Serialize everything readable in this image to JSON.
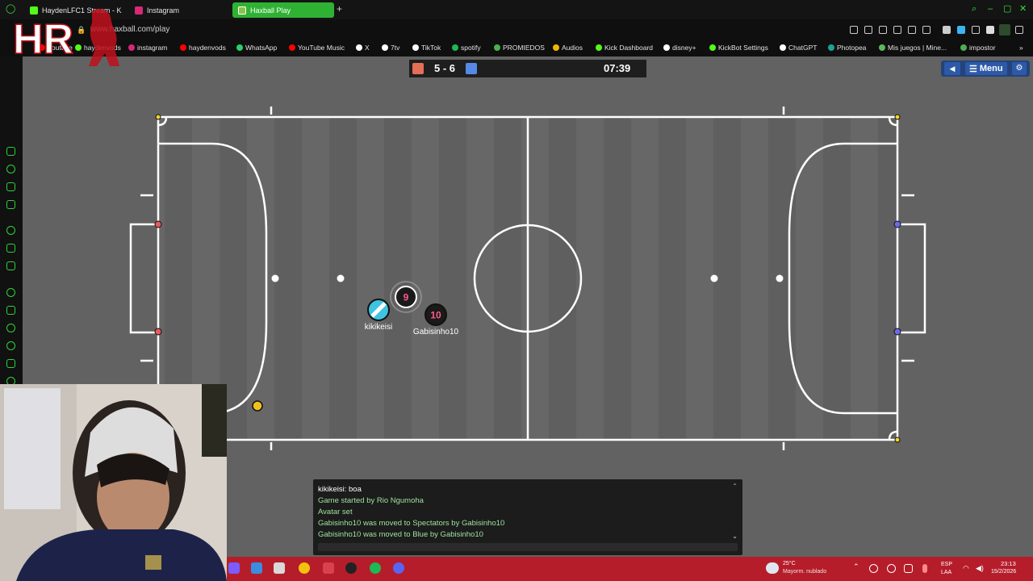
{
  "browser": {
    "tabs": [
      {
        "label": "HaydenLFC1 Stream - K",
        "color": "#53fc18",
        "active": false
      },
      {
        "label": "Instagram",
        "color": "#d62976",
        "active": false
      },
      {
        "label": "Haxball Play",
        "color": "#8bc34a",
        "active": true
      }
    ],
    "new_tab_label": "+",
    "url": "www.haxball.com/play",
    "bookmarks": [
      {
        "label": "Youtube",
        "color": "#ff0000"
      },
      {
        "label": "haydenvods",
        "color": "#53fc18"
      },
      {
        "label": "instagram",
        "color": "#d62976"
      },
      {
        "label": "haydenvods",
        "color": "#ff0000"
      },
      {
        "label": "WhatsApp",
        "color": "#25d366"
      },
      {
        "label": "YouTube Music",
        "color": "#ff0000"
      },
      {
        "label": "X",
        "color": "#ffffff"
      },
      {
        "label": "7tv",
        "color": "#ffffff"
      },
      {
        "label": "TikTok",
        "color": "#ffffff"
      },
      {
        "label": "spotify",
        "color": "#1db954"
      },
      {
        "label": "PROMIEDOS",
        "color": "#4caf50"
      },
      {
        "label": "Audios",
        "color": "#f2b705"
      },
      {
        "label": "Kick Dashboard",
        "color": "#53fc18"
      },
      {
        "label": "disney+",
        "color": "#ffffff"
      },
      {
        "label": "KickBot Settings",
        "color": "#53fc18"
      },
      {
        "label": "ChatGPT",
        "color": "#ffffff"
      },
      {
        "label": "Photopea",
        "color": "#18a497"
      },
      {
        "label": "Mis juegos | Mine...",
        "color": "#5cb85c"
      },
      {
        "label": "impostor",
        "color": "#4caf50"
      }
    ],
    "bookmarks_more": "»"
  },
  "overlay": {
    "logo_text": "HR"
  },
  "hud": {
    "score": "5 - 6",
    "time": "07:39",
    "red_color": "#e56e56",
    "blue_color": "#5689e5",
    "menu_label": "Menu",
    "speaker_icon": "speaker-icon",
    "settings_icon": "gear-icon"
  },
  "players": [
    {
      "name": "kikikeisi",
      "number": "",
      "team": "blue",
      "color": "#3ec3e0",
      "label_visible": true
    },
    {
      "name": "",
      "number": "9",
      "team": "red",
      "color": "#1a1a1a",
      "label_visible": false
    },
    {
      "name": "Gabisinho10",
      "number": "10",
      "team": "red",
      "color": "#1a1a1a",
      "label_visible": true
    }
  ],
  "ball_color": "#f0c020",
  "chat": {
    "messages": [
      {
        "text": "kikikeisi: boa",
        "color": "#ffffff"
      },
      {
        "text": "Game started by Rio Ngumoha",
        "color": "#9fe49f"
      },
      {
        "text": "Avatar set",
        "color": "#9fe49f"
      },
      {
        "text": "Gabisinho10 was moved to Spectators by Gabisinho10",
        "color": "#9fe49f"
      },
      {
        "text": "Gabisinho10 was moved to Blue by Gabisinho10",
        "color": "#9fe49f"
      }
    ],
    "input_placeholder": ""
  },
  "taskbar": {
    "weather_temp": "25°C",
    "weather_desc": "Mayorm. nublado",
    "lang_top": "ESP",
    "lang_bottom": "LAA",
    "time": "23:13",
    "date": "15/2/2026"
  }
}
